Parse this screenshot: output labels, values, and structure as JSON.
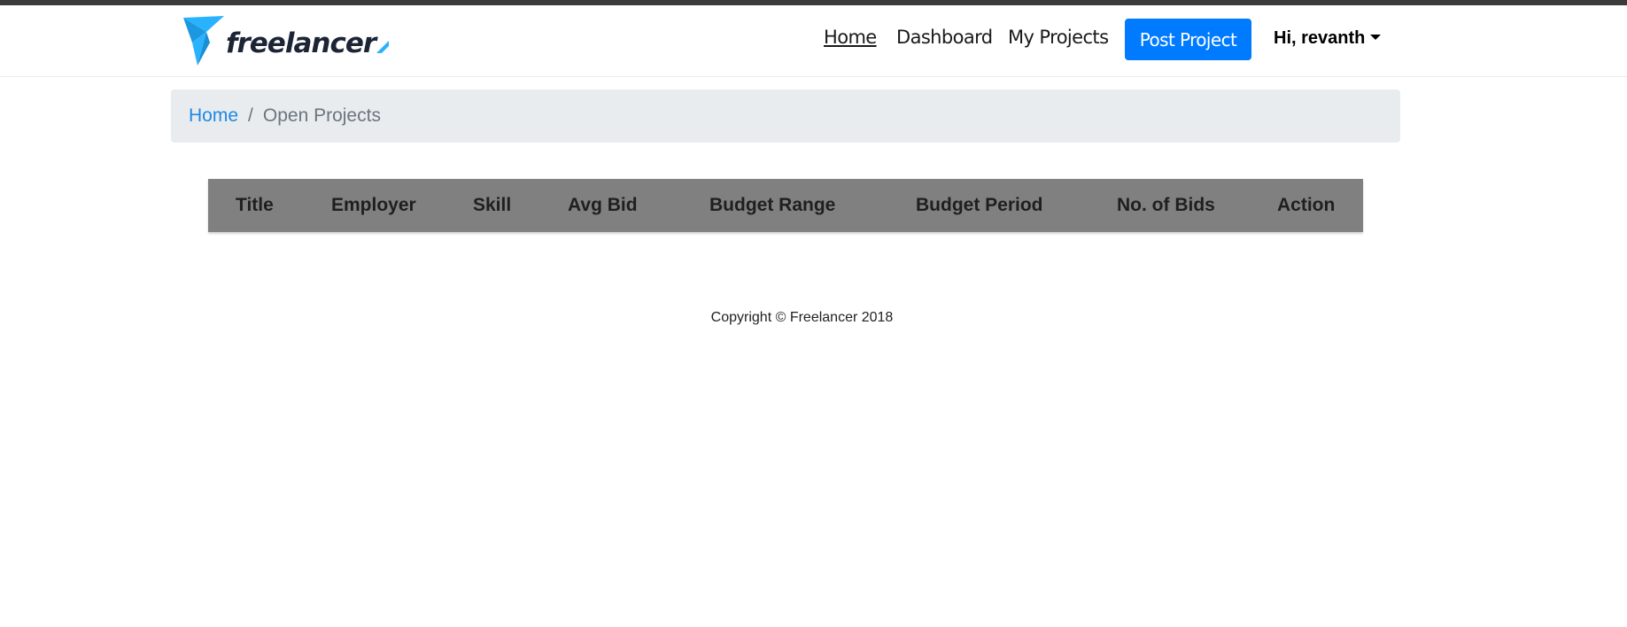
{
  "brand": {
    "name": "freelancer",
    "logo_color": "#29b2fe",
    "text_color": "#1c2436"
  },
  "nav": {
    "home": "Home",
    "dashboard": "Dashboard",
    "my_projects": "My Projects",
    "post_project": "Post Project",
    "user_greeting": "Hi, revanth",
    "accent_color": "#007bff"
  },
  "breadcrumb": {
    "home": "Home",
    "separator": "/",
    "current": "Open Projects"
  },
  "table": {
    "columns": [
      "Title",
      "Employer",
      "Skill",
      "Avg Bid",
      "Budget Range",
      "Budget Period",
      "No. of Bids",
      "Action"
    ],
    "rows": [],
    "header_bg": "#808080"
  },
  "footer": {
    "copyright": "Copyright © Freelancer 2018"
  }
}
